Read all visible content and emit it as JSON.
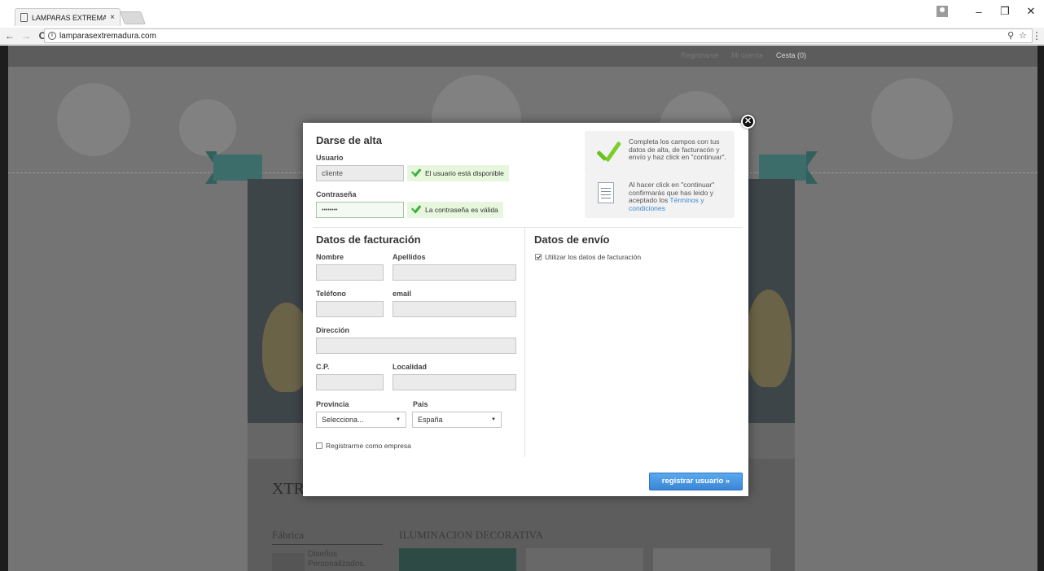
{
  "browser": {
    "tab_title": "LAMPARAS EXTREMADU",
    "tab_close": "×",
    "url": "lamparasextremadura.com",
    "nav_back": "←",
    "nav_forward": "→",
    "nav_reload": "C",
    "info_glyph": "i",
    "key_glyph": "⚲",
    "star_glyph": "☆",
    "menu_glyph": "⋮",
    "win_min": "–",
    "win_max": "❐",
    "win_close": "✕"
  },
  "site_nav": {
    "register": "Registrarse",
    "my_account": "Mi cuenta",
    "cart": "Cesta (0)"
  },
  "background": {
    "brand_partial": "XTR",
    "sidebar_title": "Fábrica",
    "section_title": "ILUMINACION DECORATIVA",
    "sidebar_item": "Diseños Personalizados."
  },
  "modal": {
    "signup_title": "Darse de alta",
    "user_label": "Usuario",
    "user_value": "cliente",
    "user_ok": "El usuario está disponible",
    "password_label": "Contraseña",
    "password_value": "••••••••",
    "password_ok": "La contraseña es válida",
    "info1": "Completa los campos con tus datos de alta, de facturacón y envío y haz click en \"continuar\".",
    "info2_prefix": "Al hacer click en \"continuar\" confirmarás que has leido y aceptado los ",
    "info2_link": "Términos y condiciones",
    "billing_title": "Datos de facturación",
    "first_name_label": "Nombre",
    "last_name_label": "Apellidos",
    "phone_label": "Teléfono",
    "email_label": "email",
    "address_label": "Dirección",
    "zip_label": "C.P.",
    "city_label": "Localidad",
    "province_label": "Provincia",
    "province_value": "Selecciona...",
    "country_label": "Pais",
    "country_value": "España",
    "company_checkbox": "Registrarme como empresa",
    "shipping_title": "Datos de envío",
    "use_billing_checkbox": "Utilizar los datos de facturación",
    "submit": "registrar usuario »",
    "close_glyph": "✕",
    "select_arrow": "▼"
  },
  "colors": {
    "accent_blue": "#3a86d6",
    "ok_green": "#3cae3c",
    "ok_bg": "#e7f7dd",
    "overlay": "#4d4d4d"
  }
}
